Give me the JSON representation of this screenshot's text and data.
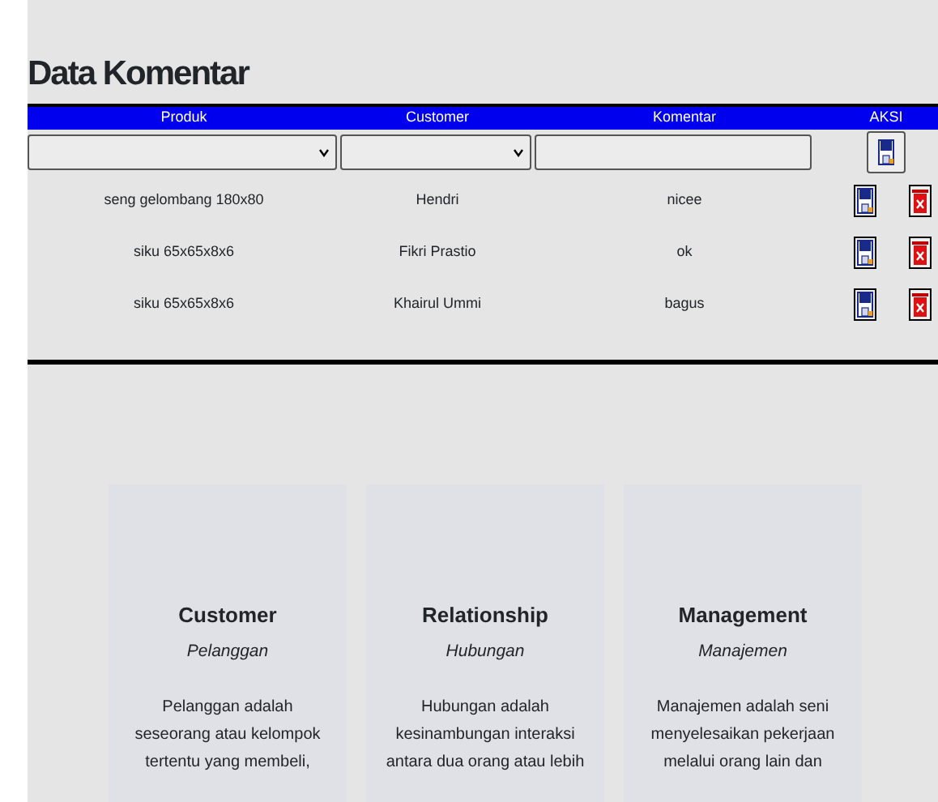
{
  "title": "Data Komentar",
  "table": {
    "columns": [
      "Produk",
      "Customer",
      "Komentar",
      "AKSI"
    ],
    "filters": [
      {
        "kind": "select"
      },
      {
        "kind": "select"
      },
      {
        "kind": "text"
      }
    ],
    "rows": [
      {
        "produk": "seng gelombang 180x80",
        "customer": "Hendri",
        "komentar": "nicee"
      },
      {
        "produk": "siku 65x65x8x6",
        "customer": "Fikri Prastio",
        "komentar": "ok"
      },
      {
        "produk": "siku 65x65x8x6",
        "customer": "Khairul Ummi",
        "komentar": "bagus"
      }
    ]
  },
  "cards": [
    {
      "title": "Customer",
      "subtitle": "Pelanggan",
      "text": "Pelanggan adalah seseorang atau kelompok tertentu yang membeli,"
    },
    {
      "title": "Relationship",
      "subtitle": "Hubungan",
      "text": "Hubungan adalah kesinambungan interaksi antara dua orang atau lebih"
    },
    {
      "title": "Management",
      "subtitle": "Manajemen",
      "text": "Manajemen adalah seni menyelesaikan pekerjaan melalui orang lain dan"
    }
  ]
}
